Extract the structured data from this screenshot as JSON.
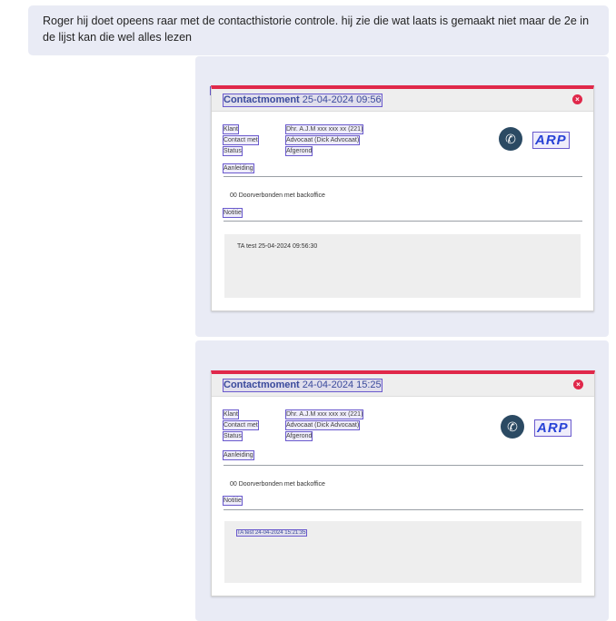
{
  "message": {
    "text": "Roger hij doet opeens raar met de contacthistorie controle. hij zie die wat laats is gemaakt niet maar de 2e in de lijst kan die wel alles lezen"
  },
  "cards": [
    {
      "title_label": "Contactmoment",
      "title_timestamp": "25-04-2024 09:56",
      "fields": [
        {
          "label": "Klant",
          "value": "Dhr. A.J.M xxx xxx xx (221)"
        },
        {
          "label": "Contact met",
          "value": "Advocaat (Dick Advocaat)"
        },
        {
          "label": "Status",
          "value": "Afgerond"
        }
      ],
      "aanleiding_label": "Aanleiding",
      "aanleiding_text": "00 Doorverbonden met backoffice",
      "notitie_label": "Notitie",
      "notitie_text": "TA test 25-04-2024 09:56:30",
      "logo_text": "ARP",
      "close_glyph": "×",
      "phone_glyph": "✆"
    },
    {
      "title_label": "Contactmoment",
      "title_timestamp": "24-04-2024 15:25",
      "fields": [
        {
          "label": "Klant",
          "value": "Dhr. A.J.M xxx xxx xx (221)"
        },
        {
          "label": "Contact met",
          "value": "Advocaat (Dick Advocaat)"
        },
        {
          "label": "Status",
          "value": "Afgerond"
        }
      ],
      "aanleiding_label": "Aanleiding",
      "aanleiding_text": "00 Doorverbonden met backoffice",
      "notitie_label": "Notitie",
      "notitie_text": "TA test 24-04-2024 15:21:35",
      "logo_text": "ARP",
      "close_glyph": "×",
      "phone_glyph": "✆"
    }
  ],
  "colors": {
    "accent_red": "#e0284a",
    "bubble_bg": "#e9ebf5",
    "title_blue": "#3a4a9c",
    "highlight": "#6a5acd",
    "logo_blue": "#2742d6"
  },
  "icons": {
    "close": "close-icon",
    "phone": "phone-icon"
  }
}
